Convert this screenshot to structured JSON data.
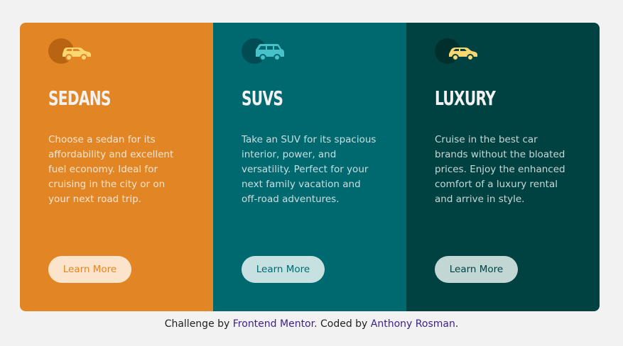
{
  "cards": [
    {
      "icon": "sedan-car-icon",
      "title": "Sedans",
      "text": "Choose a sedan for its affordability and excellent fuel economy. Ideal for cruising in the city or on your next road trip.",
      "button": "Learn More",
      "accent": "#e28625"
    },
    {
      "icon": "suv-car-icon",
      "title": "SUVs",
      "text": "Take an SUV for its spacious interior, power, and versatility. Perfect for your next family vacation and off-road adventures.",
      "button": "Learn More",
      "accent": "#006970"
    },
    {
      "icon": "luxury-car-icon",
      "title": "Luxury",
      "text": "Cruise in the best car brands without the bloated prices. Enjoy the enhanced comfort of a luxury rental and arrive in style.",
      "button": "Learn More",
      "accent": "#004241"
    }
  ],
  "attribution": {
    "prefix": "Challenge by ",
    "link1": "Frontend Mentor",
    "middle": ". Coded by ",
    "link2": "Anthony Rosman",
    "suffix": "."
  }
}
